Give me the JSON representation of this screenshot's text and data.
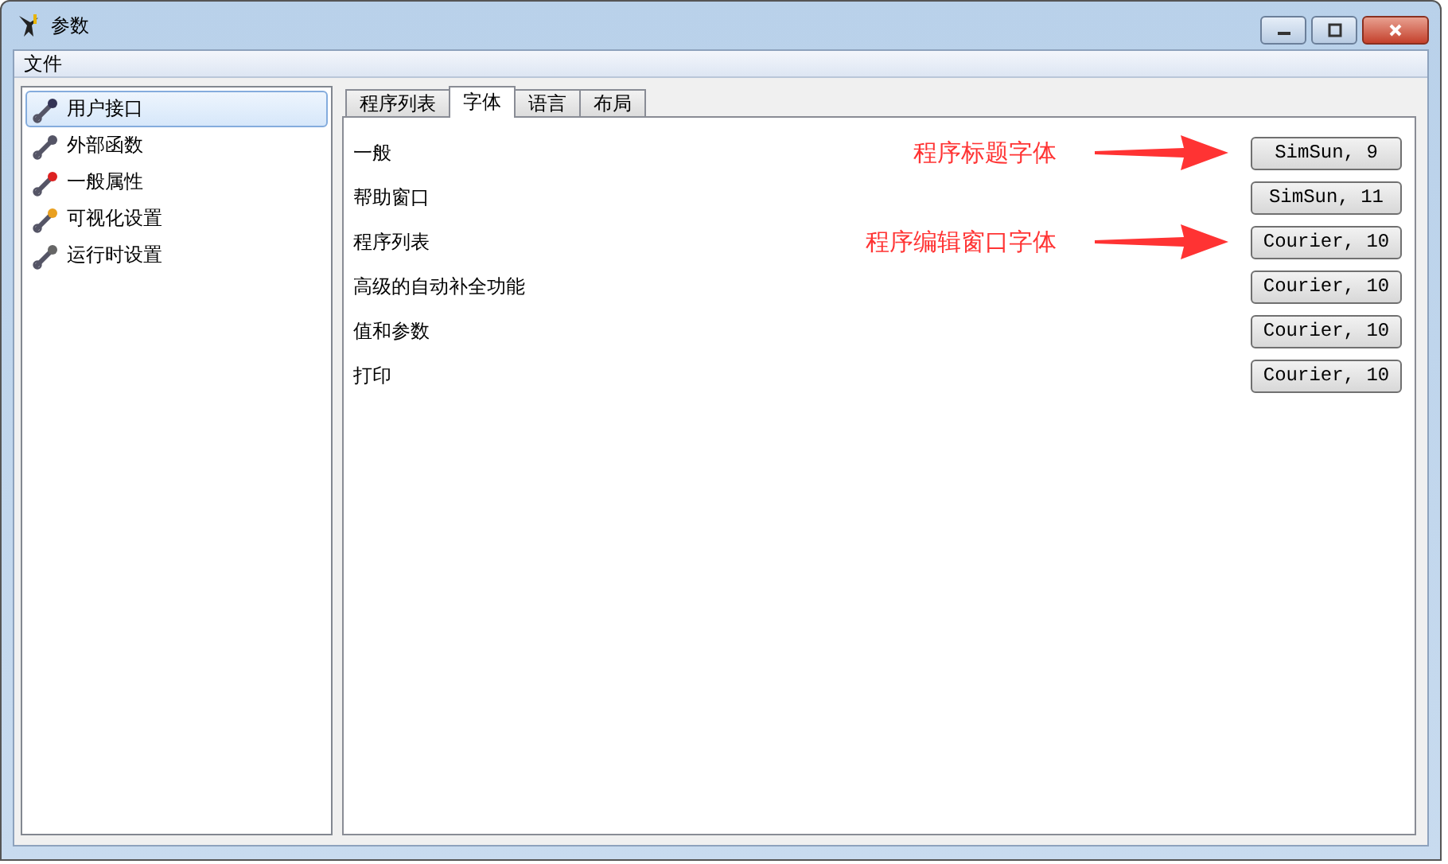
{
  "window": {
    "title": "参数"
  },
  "menu": [
    "文件"
  ],
  "sidebar": {
    "items": [
      {
        "label": "用户接口",
        "selected": true
      },
      {
        "label": "外部函数",
        "selected": false
      },
      {
        "label": "一般属性",
        "selected": false
      },
      {
        "label": "可视化设置",
        "selected": false
      },
      {
        "label": "运行时设置",
        "selected": false
      }
    ]
  },
  "tabs": [
    {
      "label": "程序列表",
      "selected": false
    },
    {
      "label": "字体",
      "selected": true
    },
    {
      "label": "语言",
      "selected": false
    },
    {
      "label": "布局",
      "selected": false
    }
  ],
  "fonts": [
    {
      "label": "一般",
      "value": "SimSun, 9",
      "annotation": "程序标题字体"
    },
    {
      "label": "帮助窗口",
      "value": "SimSun, 11"
    },
    {
      "label": "程序列表",
      "value": "Courier, 10",
      "annotation": "程序编辑窗口字体"
    },
    {
      "label": "高级的自动补全功能",
      "value": "Courier, 10"
    },
    {
      "label": "值和参数",
      "value": "Courier, 10"
    },
    {
      "label": "打印",
      "value": "Courier, 10"
    }
  ]
}
